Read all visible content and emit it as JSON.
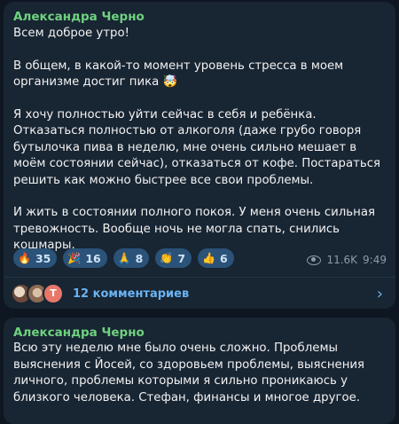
{
  "messages": [
    {
      "author": "Александра Черно",
      "text": "Всем доброе утро!\n\nВ общем, в какой-то момент уровень стресса в моем организме достиг пика 🤯\n\nЯ хочу полностью уйти сейчас в себя и ребёнка. Отказаться полностью от алкоголя (даже грубо говоря бутылочка пива в неделю, мне очень сильно мешает в моём состоянии сейчас), отказаться от кофе. Постараться решить как можно быстрее все свои проблемы.\n\nИ жить в состоянии полного покоя. У меня очень сильная тревожность. Вообще ночь не могла спать, снились кошмары.",
      "reactions": [
        {
          "emoji": "🔥",
          "icon": "fire",
          "count": "35"
        },
        {
          "emoji": "🎉",
          "icon": "party-popper",
          "count": "16"
        },
        {
          "emoji": "🙏",
          "icon": "folded-hands",
          "count": "8"
        },
        {
          "emoji": "👏",
          "icon": "clapping-hands",
          "count": "7"
        },
        {
          "emoji": "👍",
          "icon": "thumbs-up",
          "count": "6"
        }
      ],
      "views": "11.6K",
      "time": "9:49",
      "comments": {
        "label": "12 комментариев",
        "avatar_letter": "Т"
      }
    },
    {
      "author": "Александра Черно",
      "text": "Всю эту неделю мне было очень сложно. Проблемы выяснения с Йосей, со здоровьем проблемы, выяснения личного, проблемы которыми я сильно проникаюсь у близкого человека. Стефан, финансы и многое другое."
    }
  ],
  "colors": {
    "background": "#0e1621",
    "bubble": "#182533",
    "author": "#6fd27f",
    "link": "#6ab3f3",
    "reaction_pill": "#2b5278"
  }
}
